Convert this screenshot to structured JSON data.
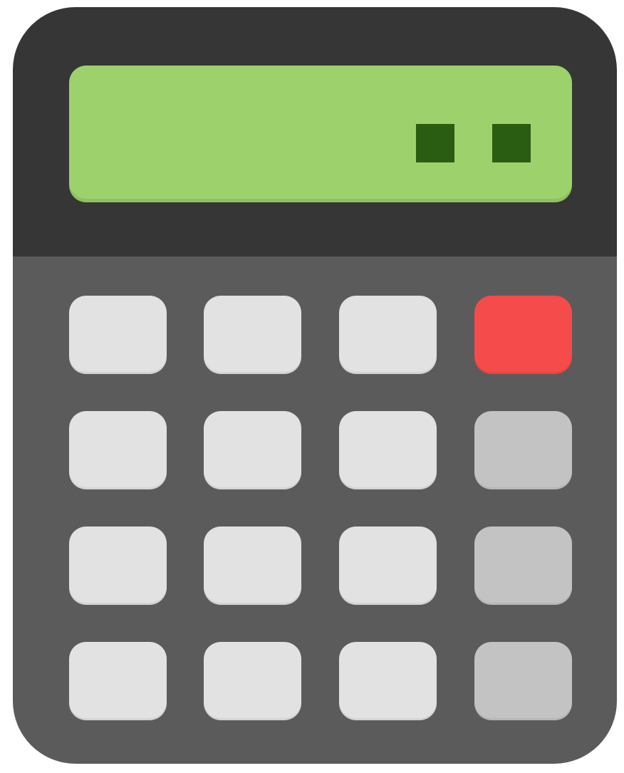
{
  "calculator": {
    "colors": {
      "body_top": "#363636",
      "body_bottom": "#5b5b5b",
      "display": "#9dd16c",
      "display_dot": "#2a5c12",
      "key_light": "#e2e2e2",
      "key_gray": "#c3c3c3",
      "key_red": "#f54b4b"
    },
    "display": {
      "indicator_count": 2
    },
    "keys": [
      [
        "light",
        "light",
        "light",
        "red"
      ],
      [
        "light",
        "light",
        "light",
        "gray"
      ],
      [
        "light",
        "light",
        "light",
        "gray"
      ],
      [
        "light",
        "light",
        "light",
        "gray"
      ]
    ]
  }
}
